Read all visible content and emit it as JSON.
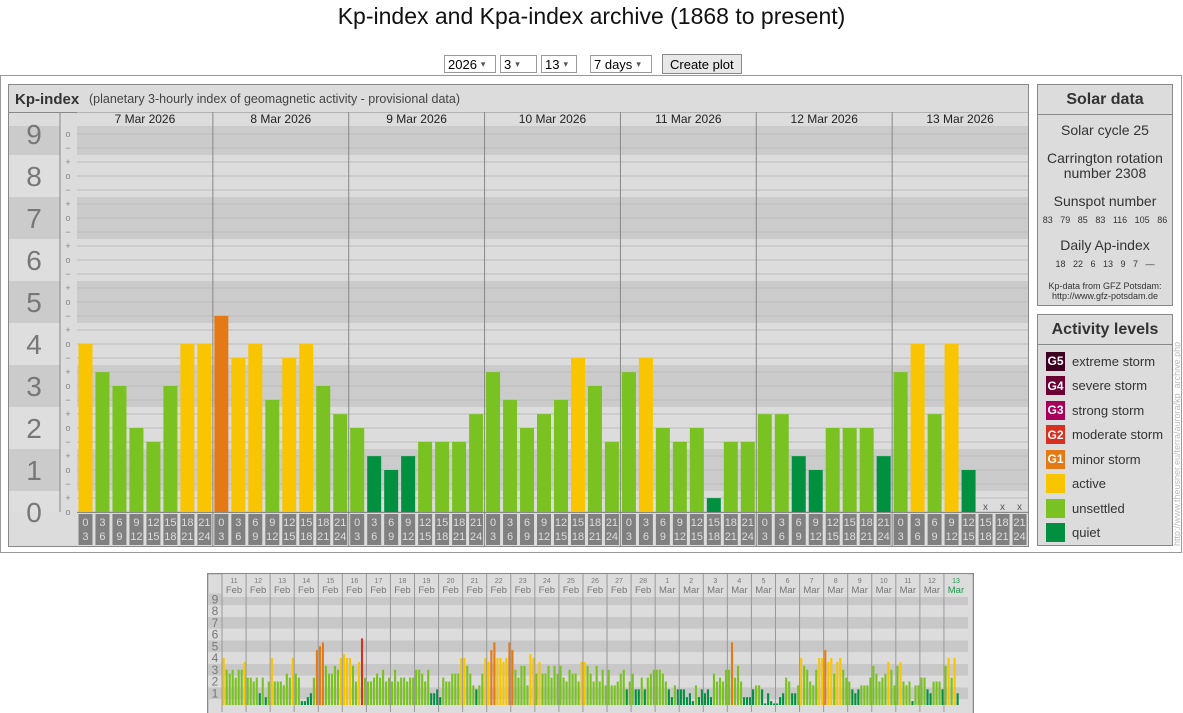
{
  "page_title": "Kp-index and Kpa-index archive (1868 to present)",
  "controls": {
    "year": "2026",
    "month": "3",
    "day": "13",
    "range": "7 days",
    "create_label": "Create plot"
  },
  "solar": {
    "header": "Solar data",
    "cycle": "Solar cycle 25",
    "carrington_line1": "Carrington rotation",
    "carrington_line2": "number 2308",
    "sunspot_label": "Sunspot number",
    "sunspot_values": "83 79 85 83 116 105 86",
    "ap_label": "Daily Ap-index",
    "ap_values": "18 22 6 13 9 7 —",
    "source_line1": "Kp-data from GFZ Potsdam:",
    "source_line2": "http://www.gfz-potsdam.de"
  },
  "activity": {
    "header": "Activity levels",
    "levels": [
      {
        "code": "G5",
        "label": "extreme storm",
        "color": "#3e0020"
      },
      {
        "code": "G4",
        "label": "severe storm",
        "color": "#6b0035"
      },
      {
        "code": "G3",
        "label": "strong storm",
        "color": "#a8005a"
      },
      {
        "code": "G2",
        "label": "moderate storm",
        "color": "#d8301f"
      },
      {
        "code": "G1",
        "label": "minor storm",
        "color": "#e47a16"
      },
      {
        "code": "",
        "label": "active",
        "color": "#f9c500"
      },
      {
        "code": "",
        "label": "unsettled",
        "color": "#7ac122"
      },
      {
        "code": "",
        "label": "quiet",
        "color": "#00903f"
      }
    ]
  },
  "watermark": "http://www.theusner.eu/terra/aurora/kp_archive.php",
  "chart_data": [
    {
      "type": "bar",
      "title": "Kp-index",
      "subtitle": "(planetary 3-hourly index of geomagnetic activity - provisional data)",
      "ylim": [
        0,
        9
      ],
      "yticks": [
        "0",
        "1",
        "2",
        "3",
        "4",
        "5",
        "6",
        "7",
        "8",
        "9"
      ],
      "sublevel_labels": [
        "−",
        "o",
        "+"
      ],
      "missing_label": "x",
      "days": [
        "7 Mar 2026",
        "8 Mar 2026",
        "9 Mar 2026",
        "10 Mar 2026",
        "11 Mar 2026",
        "12 Mar 2026",
        "13 Mar 2026"
      ],
      "slot_labels": [
        [
          "0",
          "3"
        ],
        [
          "3",
          "6"
        ],
        [
          "6",
          "9"
        ],
        [
          "9",
          "12"
        ],
        [
          "12",
          "15"
        ],
        [
          "15",
          "18"
        ],
        [
          "18",
          "21"
        ],
        [
          "21",
          "24"
        ]
      ],
      "values": [
        [
          4,
          3.33,
          3,
          2,
          1.67,
          3,
          4,
          4
        ],
        [
          4.67,
          3.67,
          4,
          2.67,
          3.67,
          4,
          3,
          2.33
        ],
        [
          2,
          1.33,
          1,
          1.33,
          1.67,
          1.67,
          1.67,
          2.33
        ],
        [
          3.33,
          2.67,
          2,
          2.33,
          2.67,
          3.67,
          3,
          1.67
        ],
        [
          3.33,
          3.67,
          2,
          1.67,
          2,
          0.33,
          1.67,
          1.67
        ],
        [
          2.33,
          2.33,
          1.33,
          1,
          2,
          2,
          2,
          1.33
        ],
        [
          3.33,
          4,
          2.33,
          4,
          1,
          null,
          null,
          null
        ]
      ]
    },
    {
      "type": "bar",
      "title": "30-day overview",
      "ylim": [
        0,
        9
      ],
      "yticks": [
        "1",
        "2",
        "3",
        "4",
        "5",
        "6",
        "7",
        "8",
        "9"
      ],
      "days": [
        [
          "11",
          "Feb"
        ],
        [
          "12",
          "Feb"
        ],
        [
          "13",
          "Feb"
        ],
        [
          "14",
          "Feb"
        ],
        [
          "15",
          "Feb"
        ],
        [
          "16",
          "Feb"
        ],
        [
          "17",
          "Feb"
        ],
        [
          "18",
          "Feb"
        ],
        [
          "19",
          "Feb"
        ],
        [
          "20",
          "Feb"
        ],
        [
          "21",
          "Feb"
        ],
        [
          "22",
          "Feb"
        ],
        [
          "23",
          "Feb"
        ],
        [
          "24",
          "Feb"
        ],
        [
          "25",
          "Feb"
        ],
        [
          "26",
          "Feb"
        ],
        [
          "27",
          "Feb"
        ],
        [
          "28",
          "Feb"
        ],
        [
          "1",
          "Mar"
        ],
        [
          "2",
          "Mar"
        ],
        [
          "3",
          "Mar"
        ],
        [
          "4",
          "Mar"
        ],
        [
          "5",
          "Mar"
        ],
        [
          "6",
          "Mar"
        ],
        [
          "7",
          "Mar"
        ],
        [
          "8",
          "Mar"
        ],
        [
          "9",
          "Mar"
        ],
        [
          "10",
          "Mar"
        ],
        [
          "11",
          "Mar"
        ],
        [
          "12",
          "Mar"
        ],
        [
          "13",
          "Mar"
        ]
      ],
      "values": [
        [
          4,
          3,
          2.67,
          3,
          2.33,
          3,
          3,
          3.67
        ],
        [
          2.33,
          2.33,
          2,
          2.33,
          1,
          2.33,
          0.67,
          2
        ],
        [
          4,
          2,
          2,
          2,
          1.67,
          2.67,
          2.33,
          4
        ],
        [
          2.67,
          2.33,
          0.33,
          0.33,
          0.67,
          1,
          2.33,
          4.67
        ],
        [
          5,
          5.33,
          3.33,
          2.67,
          2.67,
          3.33,
          3,
          4
        ],
        [
          4.33,
          4,
          4,
          3.33,
          2,
          3.67,
          5.67,
          2.33
        ],
        [
          2,
          2,
          2.33,
          2.67,
          2.33,
          3,
          2,
          2.33
        ],
        [
          2,
          3,
          2,
          2.33,
          2.33,
          2,
          2.33,
          2.33
        ],
        [
          3,
          3,
          2.67,
          2,
          3,
          1,
          1,
          1.33
        ],
        [
          0.67,
          2.33,
          2,
          2,
          2.67,
          2.67,
          2.67,
          4
        ],
        [
          4,
          3.33,
          2.67,
          1.67,
          1.33,
          1.67,
          2.67,
          4
        ],
        [
          3.67,
          4.67,
          5.33,
          4,
          4,
          3.67,
          4,
          5.33
        ],
        [
          4.67,
          3,
          2.33,
          3.33,
          3.33,
          1.67,
          4.33,
          4
        ],
        [
          2.67,
          3.67,
          2.67,
          2.67,
          3.33,
          2.33,
          3.33,
          2.67
        ],
        [
          3.33,
          2.33,
          2,
          3,
          2.67,
          2.67,
          2,
          3.67
        ],
        [
          3.67,
          3.33,
          2.67,
          2,
          3.33,
          2,
          3,
          1.67
        ],
        [
          3,
          1.67,
          1.67,
          2,
          2.67,
          3,
          1.33,
          2
        ],
        [
          2.67,
          1.33,
          1.33,
          2.33,
          1.33,
          2.33,
          2.67,
          3
        ],
        [
          3,
          3,
          2.67,
          2,
          1.33,
          0.67,
          1.67,
          1.33
        ],
        [
          1.33,
          1.33,
          0.67,
          1,
          0.33,
          1.67,
          0.67,
          1.33
        ],
        [
          1,
          1.33,
          0.67,
          2.67,
          2,
          2.33,
          2,
          3
        ],
        [
          3,
          5.33,
          2.33,
          3.33,
          2,
          0.67,
          0.67,
          0.67
        ],
        [
          1.33,
          1.67,
          1.67,
          1.33,
          0,
          1,
          0.33,
          0
        ],
        [
          0,
          0.67,
          1,
          2.33,
          2,
          1,
          1,
          1.67
        ],
        [
          4,
          3.33,
          3,
          2,
          1.67,
          3,
          4,
          4
        ],
        [
          4.67,
          3.67,
          4,
          2.67,
          3.67,
          4,
          3,
          2.33
        ],
        [
          2,
          1.33,
          1,
          1.33,
          1.67,
          1.67,
          1.67,
          2.33
        ],
        [
          3.33,
          2.67,
          2,
          2.33,
          2.67,
          3.67,
          3,
          1.67
        ],
        [
          3.33,
          3.67,
          2,
          1.67,
          2,
          0.33,
          1.67,
          1.67
        ],
        [
          2.33,
          2.33,
          1.33,
          1,
          2,
          2,
          2,
          1.33
        ],
        [
          3.33,
          4,
          2.33,
          4,
          1,
          null,
          null,
          null
        ]
      ]
    }
  ]
}
